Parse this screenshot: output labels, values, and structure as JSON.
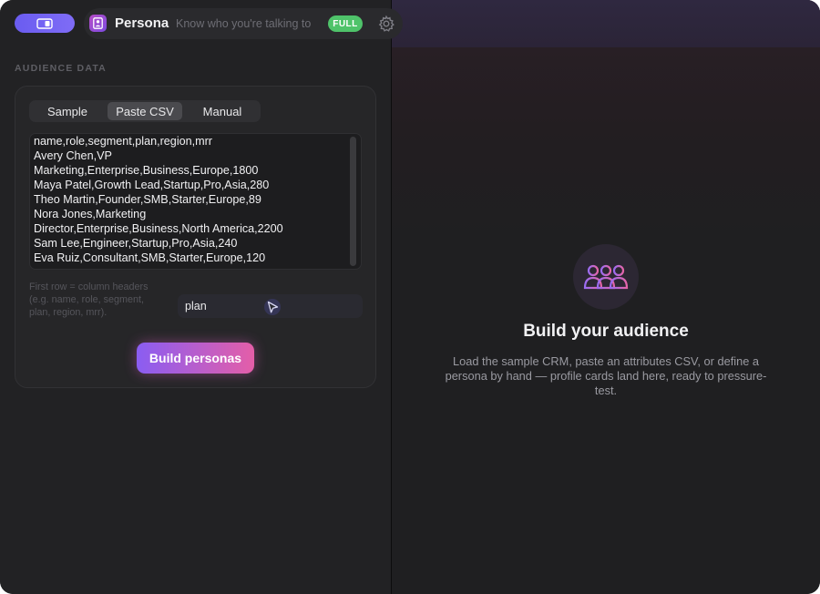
{
  "titlebar": {
    "app_title": "Persona",
    "app_subtitle": "Know who you're talking to",
    "mode_badge": "FULL",
    "icons": [
      "sidebar-icon",
      "persona-app-icon",
      "gear-icon"
    ]
  },
  "left_panel": {
    "section_label": "AUDIENCE DATA",
    "tabs": [
      {
        "label": "Sample",
        "active": false
      },
      {
        "label": "Paste CSV",
        "active": true
      },
      {
        "label": "Manual",
        "active": false
      }
    ],
    "csv_lines": [
      "name,role,segment,plan,region,mrr",
      "Avery Chen,VP",
      "Marketing,Enterprise,Business,Europe,1800",
      "Maya Patel,Growth Lead,Startup,Pro,Asia,280",
      "Theo Martin,Founder,SMB,Starter,Europe,89",
      "Nora Jones,Marketing",
      "Director,Enterprise,Business,North America,2200",
      "Sam Lee,Engineer,Startup,Pro,Asia,240",
      "Eva Ruiz,Consultant,SMB,Starter,Europe,120"
    ],
    "hint_text": "First row = column headers (e.g. name, role, segment, plan, region, mrr).",
    "column_input_value": "plan",
    "build_button_label": "Build personas"
  },
  "right_panel": {
    "empty_title": "Build your audience",
    "empty_description": "Load the sample CRM, paste an attributes CSV, or define a persona by hand — profile cards land here, ready to pressure-test.",
    "empty_icon": "people-group-icon"
  },
  "colors": {
    "accent_gradient_start": "#8a5df2",
    "accent_gradient_end": "#e45ea8",
    "badge_green": "#4fc36a",
    "sidebar_toggle": "#6a5cf0"
  }
}
